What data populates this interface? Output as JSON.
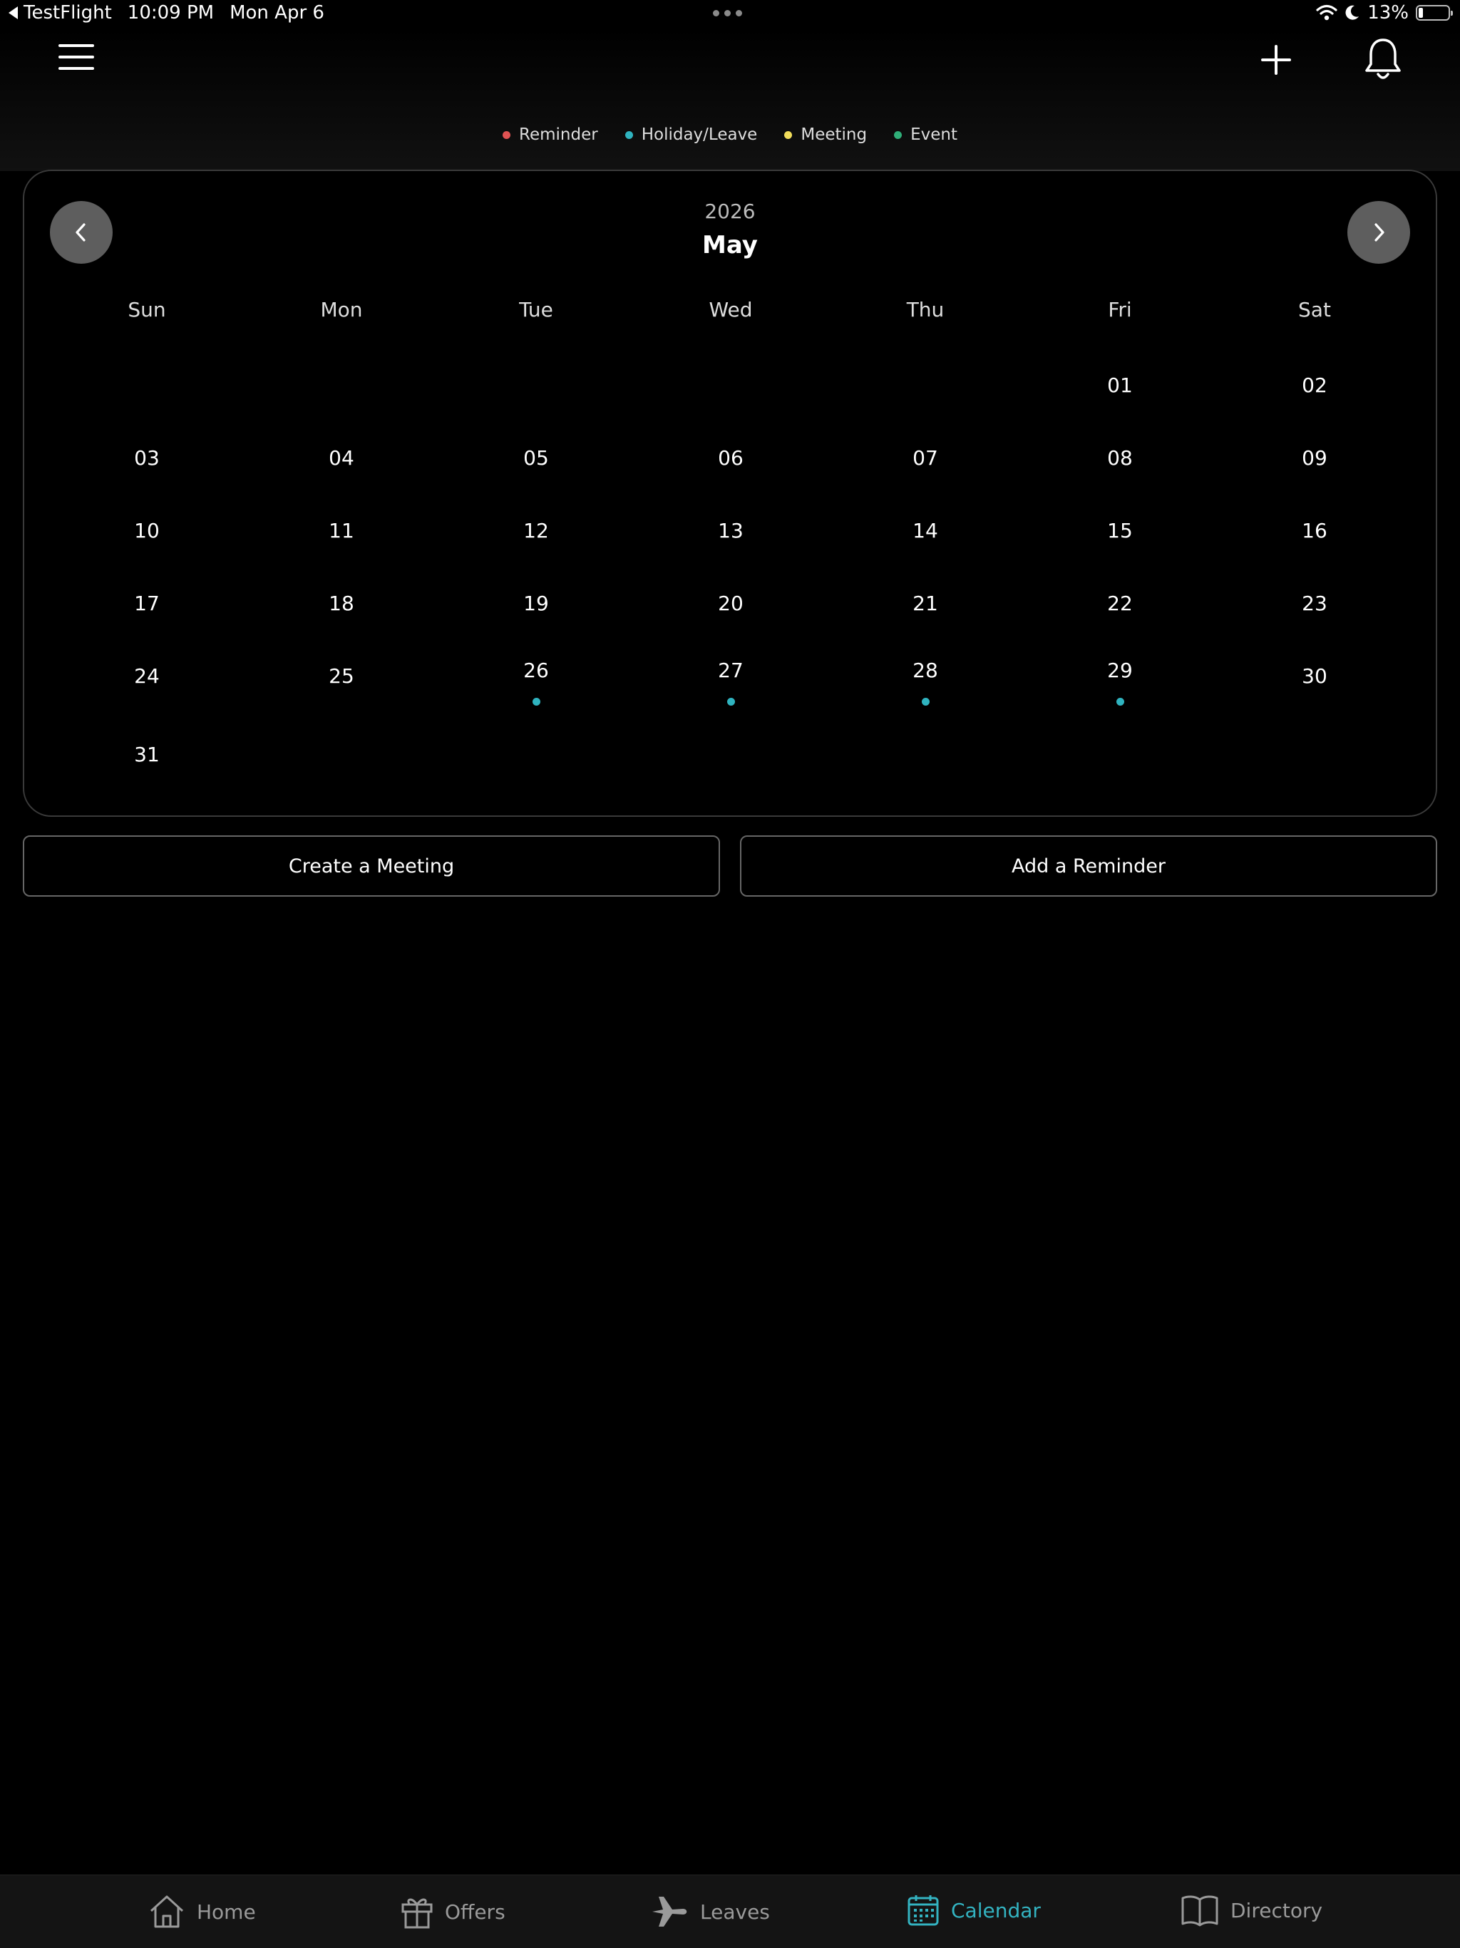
{
  "status_bar": {
    "back_app": "TestFlight",
    "time": "10:09 PM",
    "date": "Mon Apr 6",
    "battery": "13%"
  },
  "legend": [
    {
      "label": "Reminder",
      "color": "#e05252"
    },
    {
      "label": "Holiday/Leave",
      "color": "#2fb3bf"
    },
    {
      "label": "Meeting",
      "color": "#f0dc5a"
    },
    {
      "label": "Event",
      "color": "#2fae78"
    }
  ],
  "calendar": {
    "year": "2026",
    "month": "May",
    "weekdays": [
      "Sun",
      "Mon",
      "Tue",
      "Wed",
      "Thu",
      "Fri",
      "Sat"
    ],
    "first_weekday_index": 5,
    "days": [
      "01",
      "02",
      "03",
      "04",
      "05",
      "06",
      "07",
      "08",
      "09",
      "10",
      "11",
      "12",
      "13",
      "14",
      "15",
      "16",
      "17",
      "18",
      "19",
      "20",
      "21",
      "22",
      "23",
      "24",
      "25",
      "26",
      "27",
      "28",
      "29",
      "30",
      "31"
    ],
    "event_days": [
      "26",
      "27",
      "28",
      "29"
    ],
    "event_color": "#2fb3bf"
  },
  "actions": {
    "create_meeting": "Create a Meeting",
    "add_reminder": "Add a Reminder"
  },
  "tabs": [
    {
      "label": "Home",
      "icon": "home-icon",
      "active": false
    },
    {
      "label": "Offers",
      "icon": "gift-icon",
      "active": false
    },
    {
      "label": "Leaves",
      "icon": "airplane-icon",
      "active": false
    },
    {
      "label": "Calendar",
      "icon": "calendar-icon",
      "active": true
    },
    {
      "label": "Directory",
      "icon": "book-icon",
      "active": false
    }
  ],
  "colors": {
    "accent": "#33b3c1",
    "background": "#000000",
    "nav_button": "#5e5e5e"
  }
}
